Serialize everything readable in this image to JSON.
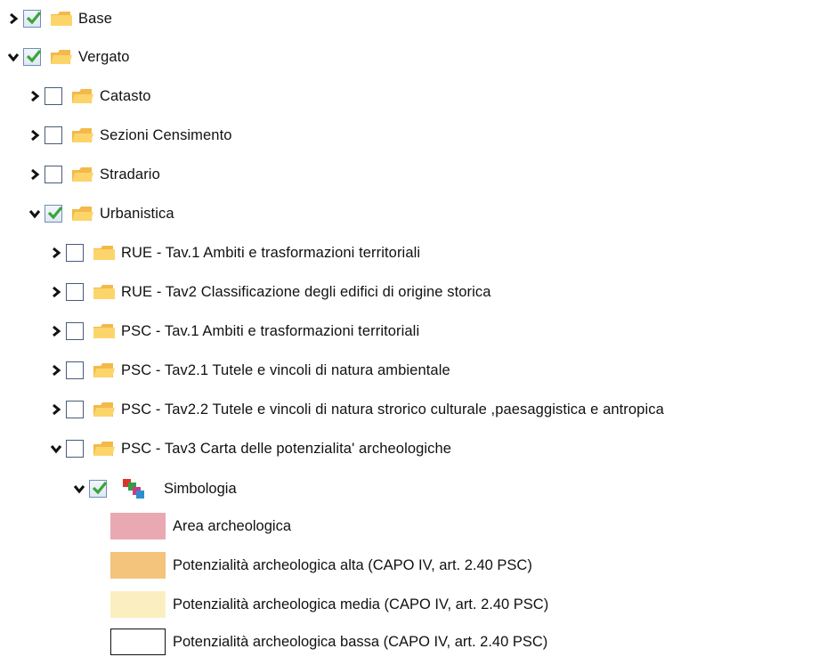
{
  "tree": {
    "nodes": [
      {
        "label": "Base",
        "checked": true,
        "expanded": false
      },
      {
        "label": "Vergato",
        "checked": true,
        "expanded": true
      },
      {
        "label": "Catasto",
        "checked": false,
        "expanded": false
      },
      {
        "label": "Sezioni Censimento",
        "checked": false,
        "expanded": false
      },
      {
        "label": "Stradario",
        "checked": false,
        "expanded": false
      },
      {
        "label": "Urbanistica",
        "checked": true,
        "expanded": true
      },
      {
        "label": "RUE - Tav.1 Ambiti e trasformazioni territoriali",
        "checked": false,
        "expanded": false
      },
      {
        "label": "RUE - Tav2 Classificazione degli edifici di origine storica",
        "checked": false,
        "expanded": false
      },
      {
        "label": "PSC - Tav.1 Ambiti e trasformazioni territoriali",
        "checked": false,
        "expanded": false
      },
      {
        "label": "PSC - Tav2.1 Tutele e vincoli di natura ambientale",
        "checked": false,
        "expanded": false
      },
      {
        "label": "PSC - Tav2.2 Tutele e vincoli di natura strorico culturale ,paesaggistica e antropica",
        "checked": false,
        "expanded": false
      },
      {
        "label": "PSC - Tav3 Carta delle potenzialita' archeologiche",
        "checked": false,
        "expanded": true
      },
      {
        "label": "Simbologia",
        "checked": true,
        "expanded": true
      }
    ]
  },
  "legend": [
    {
      "label": "Area archeologica",
      "color": "#e8a9b3"
    },
    {
      "label": "Potenzialità archeologica alta (CAPO IV, art. 2.40 PSC)",
      "color": "#f4c47c"
    },
    {
      "label": "Potenzialità archeologica media (CAPO IV, art. 2.40 PSC)",
      "color": "#fbefc2"
    },
    {
      "label": "Potenzialità archeologica bassa (CAPO IV, art. 2.40 PSC)",
      "color": "#ffffff"
    }
  ],
  "colors": {
    "folder_body": "#fcd56a",
    "folder_tab": "#f3b94a",
    "checkmark": "#3aa53a",
    "checkbox_border": "#4a5a7a"
  }
}
